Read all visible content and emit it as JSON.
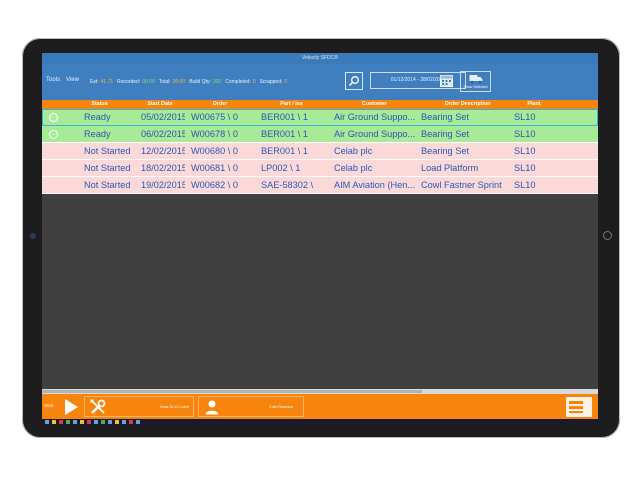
{
  "window_title": "Velocity SFDC®",
  "menu": [
    "Tools",
    "View"
  ],
  "stats": [
    {
      "label": "Est:",
      "value": "41.71"
    },
    {
      "label": "Recorded:",
      "value": "00:00"
    },
    {
      "label": "Total:",
      "value": "00:00"
    },
    {
      "label": "Build Qty:",
      "value": "300"
    },
    {
      "label": "Completed:",
      "value": "0"
    },
    {
      "label": "Scrapped:",
      "value": "0"
    }
  ],
  "date_range": "01/12/2014 - 28/02/2015",
  "show_selected_label": "Show Selected",
  "columns": [
    "Status",
    "Start Date",
    "Order",
    "Part / Iss",
    "Customer",
    "Order Description",
    "Plant"
  ],
  "rows": [
    {
      "status": "Ready",
      "start_date": "05/02/2015",
      "order": "W00675 \\ 0",
      "part": "BER001 \\ 1",
      "customer": "Air Ground Suppo...",
      "description": "Bearing Set",
      "plant": "SL10",
      "state": "ready",
      "selected": true
    },
    {
      "status": "Ready",
      "start_date": "06/02/2015",
      "order": "W00678 \\ 0",
      "part": "BER001 \\ 1",
      "customer": "Air Ground Suppo...",
      "description": "Bearing Set",
      "plant": "SL10",
      "state": "ready",
      "selected": false
    },
    {
      "status": "Not Started",
      "start_date": "12/02/2015",
      "order": "W00680 \\ 0",
      "part": "BER001 \\ 1",
      "customer": "Celab plc",
      "description": "Bearing Set",
      "plant": "SL10",
      "state": "not-started",
      "selected": false
    },
    {
      "status": "Not Started",
      "start_date": "18/02/2015",
      "order": "W00681 \\ 0",
      "part": "LP002 \\ 1",
      "customer": "Celab plc",
      "description": "Load Platform",
      "plant": "SL10",
      "state": "not-started",
      "selected": false
    },
    {
      "status": "Not Started",
      "start_date": "19/02/2015",
      "order": "W00682 \\ 0",
      "part": "SAE-58302 \\",
      "customer": "AIM Aviation (Hen...",
      "description": "Cowl Fastner Sprint",
      "plant": "SL10",
      "state": "not-started",
      "selected": false
    }
  ],
  "bottom": {
    "start_label": "Start",
    "tool_label": "Haas SL10 Lathe",
    "user_label": "Colin Reardon"
  },
  "colors": {
    "header_blue": "#3f7fc0",
    "grid_orange": "#f7840c",
    "ready_green": "#a7ea97",
    "not_started_pink": "#fbd9d9",
    "row_text": "#2a58b5"
  }
}
